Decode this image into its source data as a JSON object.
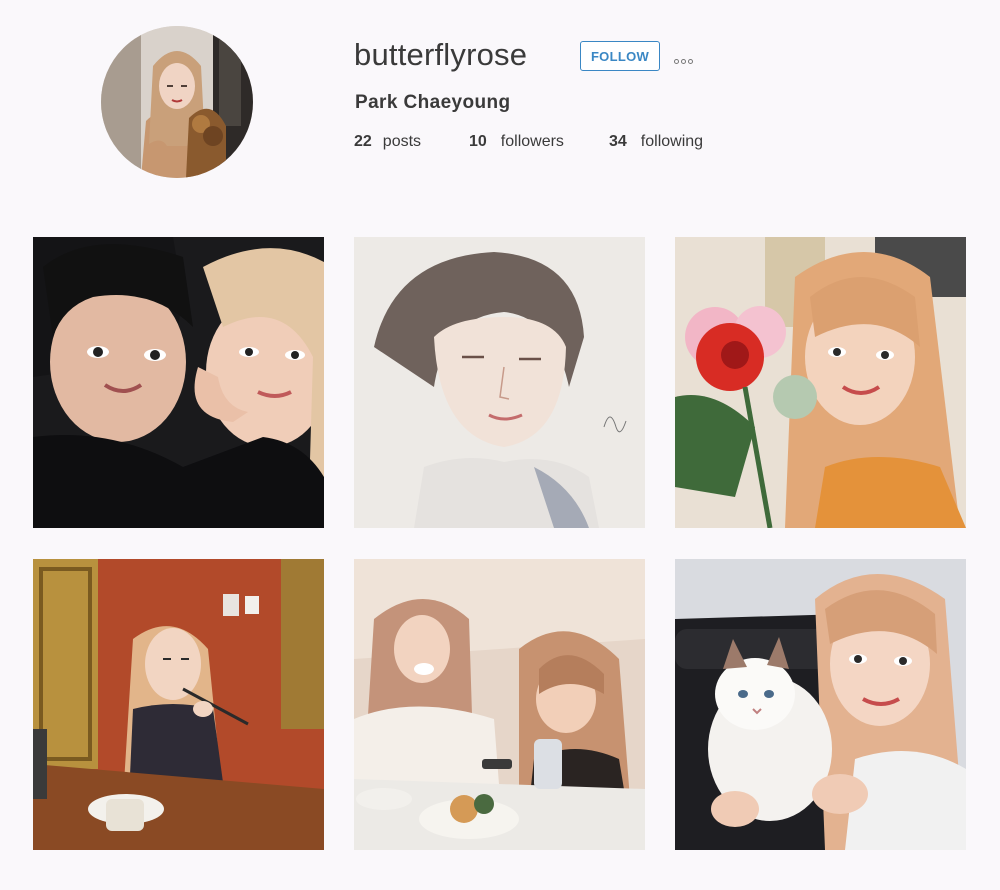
{
  "profile": {
    "username": "butterflyrose",
    "full_name": "Park Chaeyoung",
    "follow_label": "FOLLOW",
    "avatar_icon": "profile-photo",
    "more_icon": "ellipsis-icon"
  },
  "stats": {
    "posts_count": "22",
    "posts_label": "posts",
    "followers_count": "10",
    "followers_label": "followers",
    "following_count": "34",
    "following_label": "following"
  },
  "colors": {
    "background": "#faf8fb",
    "accent": "#3a87c4",
    "text": "#3a3a3a"
  },
  "posts": [
    {
      "subject": "selfie-two-people"
    },
    {
      "subject": "watercolor-portrait"
    },
    {
      "subject": "portrait-with-flowers"
    },
    {
      "subject": "restaurant-photo"
    },
    {
      "subject": "dining-friends"
    },
    {
      "subject": "holding-cat"
    }
  ]
}
